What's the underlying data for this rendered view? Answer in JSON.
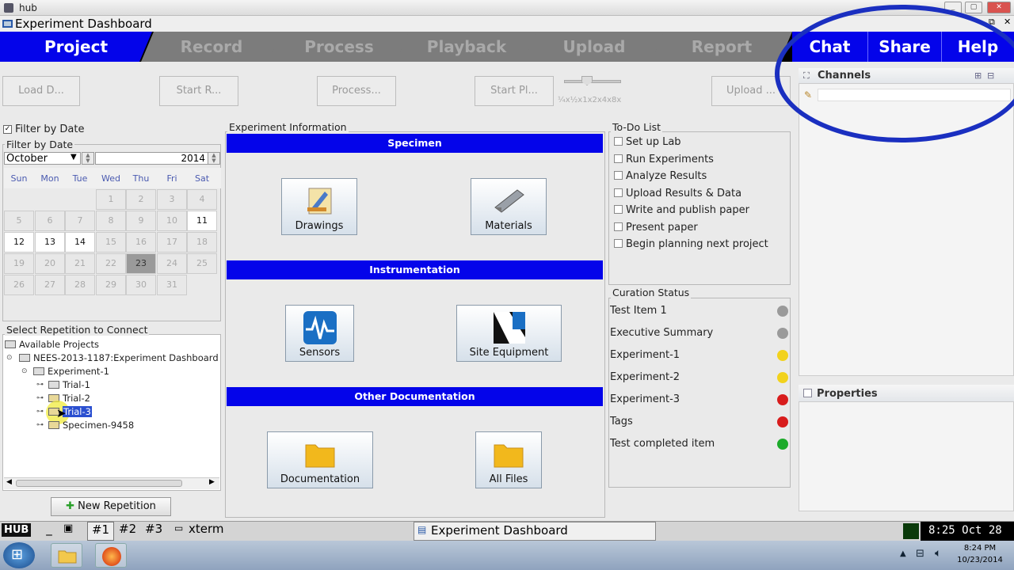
{
  "window": {
    "hub_title": "hub",
    "app_title": "Experiment Dashboard"
  },
  "nav": {
    "tabs": [
      {
        "label": "Project"
      },
      {
        "label": "Record"
      },
      {
        "label": "Process"
      },
      {
        "label": "Playback"
      },
      {
        "label": "Upload"
      },
      {
        "label": "Report"
      }
    ],
    "right": [
      {
        "label": "Chat"
      },
      {
        "label": "Share"
      },
      {
        "label": "Help"
      }
    ]
  },
  "toolbar": {
    "load": "Load D...",
    "start_record": "Start R...",
    "process": "Process...",
    "start_playback": "Start Pl...",
    "speeds": "¼x½x1x2x4x8x",
    "upload": "Upload ..."
  },
  "filter": {
    "checkbox_label": "Filter by Date",
    "group_title": "Filter by Date",
    "month": "October",
    "year": "2014",
    "weekdays": [
      "Sun",
      "Mon",
      "Tue",
      "Wed",
      "Thu",
      "Fri",
      "Sat"
    ],
    "weeks": [
      [
        "",
        "",
        "",
        "1",
        "2",
        "3",
        "4"
      ],
      [
        "5",
        "6",
        "7",
        "8",
        "9",
        "10",
        "11"
      ],
      [
        "12",
        "13",
        "14",
        "15",
        "16",
        "17",
        "18"
      ],
      [
        "19",
        "20",
        "21",
        "22",
        "23",
        "24",
        "25"
      ],
      [
        "26",
        "27",
        "28",
        "29",
        "30",
        "31",
        ""
      ]
    ]
  },
  "repetition": {
    "title": "Select Repetition to Connect",
    "root": "Available Projects",
    "project": "NEES-2013-1187:Experiment Dashboard",
    "experiment": "Experiment-1",
    "trials": [
      "Trial-1",
      "Trial-2",
      "Trial-3"
    ],
    "specimen": "Specimen-9458",
    "new_button": "New Repetition"
  },
  "experiment_info": {
    "title": "Experiment Information",
    "sections": [
      {
        "header": "Specimen",
        "buttons": [
          "Drawings",
          "Materials"
        ]
      },
      {
        "header": "Instrumentation",
        "buttons": [
          "Sensors",
          "Site Equipment"
        ]
      },
      {
        "header": "Other Documentation",
        "buttons": [
          "Documentation",
          "All Files"
        ]
      }
    ]
  },
  "todo": {
    "title": "To-Do List",
    "items": [
      "Set up Lab",
      "Run Experiments",
      "Analyze Results",
      "Upload Results & Data",
      "Write and publish paper",
      "Present paper",
      "Begin planning next project"
    ]
  },
  "curation": {
    "title": "Curation Status",
    "items": [
      {
        "label": "Test Item 1",
        "status_color": "#9a9a9a"
      },
      {
        "label": "Executive Summary",
        "status_color": "#9a9a9a"
      },
      {
        "label": "Experiment-1",
        "status_color": "#f2d21c"
      },
      {
        "label": "Experiment-2",
        "status_color": "#f2d21c"
      },
      {
        "label": "Experiment-3",
        "status_color": "#d81c1c"
      },
      {
        "label": "Tags",
        "status_color": "#d81c1c"
      },
      {
        "label": "Test completed item",
        "status_color": "#1caa2a"
      }
    ]
  },
  "channels": {
    "title": "Channels"
  },
  "properties": {
    "title": "Properties"
  },
  "taskbar": {
    "hub": "HUB",
    "workspaces": [
      "#1",
      "#2",
      "#3"
    ],
    "xterm": "xterm",
    "active_window": "Experiment Dashboard",
    "clock": "8:25 Oct 28"
  },
  "win_taskbar": {
    "time": "8:24 PM",
    "date": "10/23/2014"
  },
  "colors": {
    "accent_blue": "#0404ea",
    "annotation_ring": "#1a2fc0"
  }
}
